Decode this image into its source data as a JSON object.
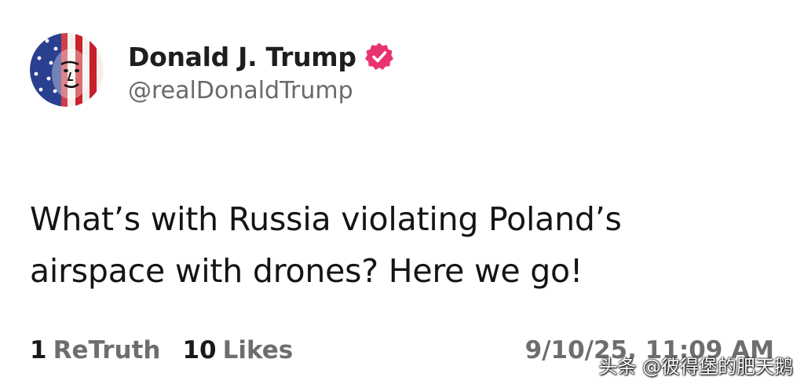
{
  "author": {
    "display_name": "Donald J. Trump",
    "handle": "@realDonaldTrump",
    "verified": true,
    "verified_color": "#e8336f",
    "avatar_icon": "flag-portrait-avatar"
  },
  "post": {
    "text_line1": "What’s with Russia violating Poland’s",
    "text_line2": "airspace with drones? Here we go!"
  },
  "stats": {
    "retruths_count": "1",
    "retruths_label": "ReTruth",
    "likes_count": "10",
    "likes_label": "Likes"
  },
  "timestamp": "9/10/25, 11:09 AM",
  "watermark": "头条 @彼得堡的肥天鹅"
}
